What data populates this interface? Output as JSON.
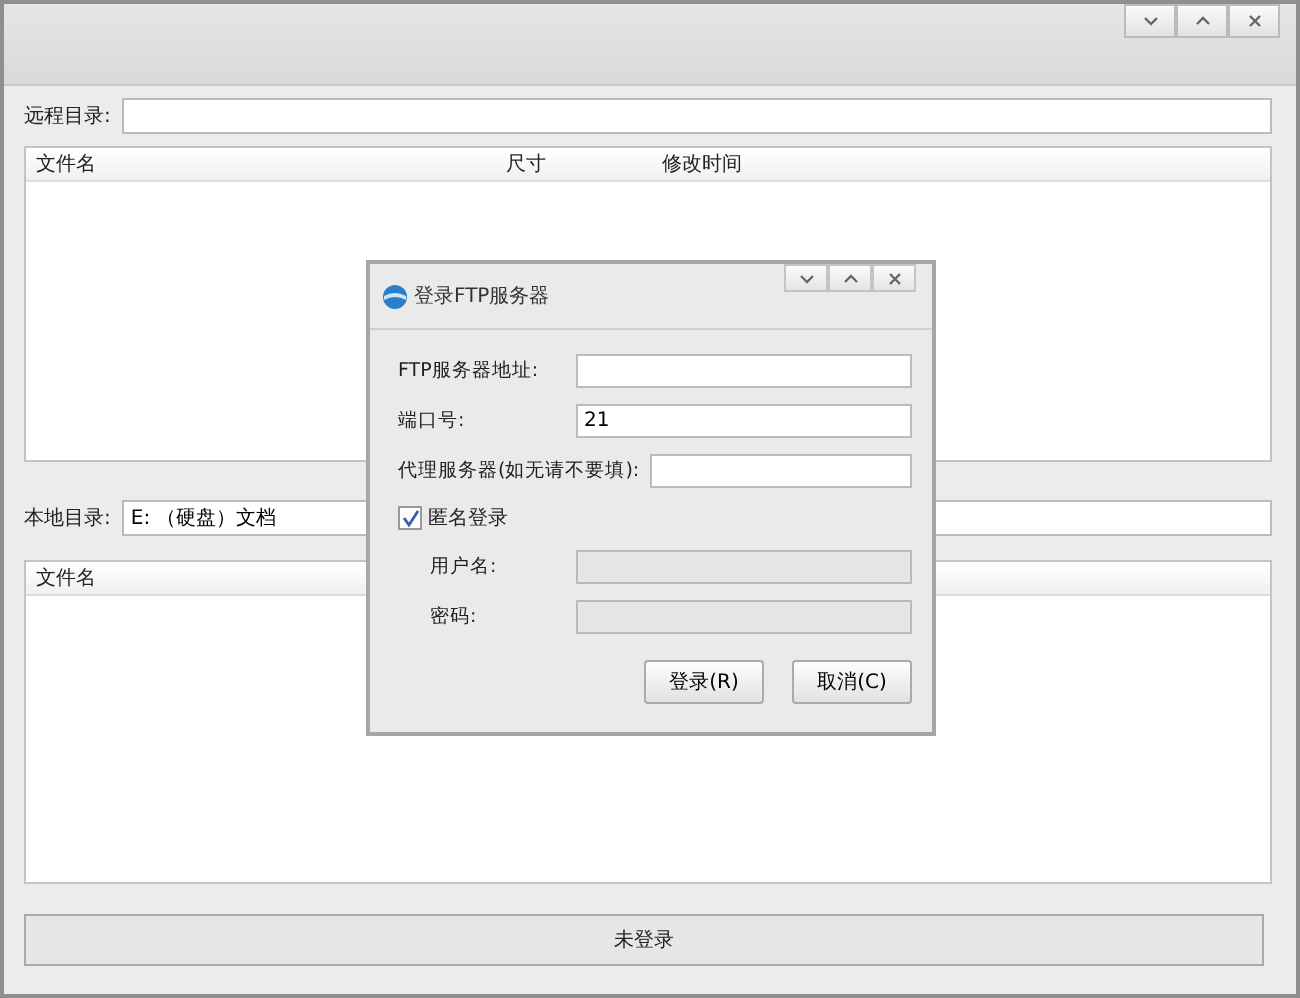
{
  "remote": {
    "label": "远程目录:",
    "columns": [
      "文件名",
      "尺寸",
      "修改时间"
    ]
  },
  "local": {
    "label": "本地目录:",
    "value": "E: （硬盘）文档",
    "columns": [
      "文件名"
    ]
  },
  "status": "未登录",
  "dialog": {
    "title": "登录FTP服务器",
    "fields": [
      {
        "label": "FTP服务器地址:"
      },
      {
        "label": "端口号:",
        "value": "21"
      },
      {
        "label": "代理服务器(如无请不要填):"
      }
    ],
    "anonymous": {
      "label": "匿名登录",
      "checked": true
    },
    "auth_fields": [
      {
        "label": "用户名:"
      },
      {
        "label": "密码:"
      }
    ],
    "buttons": [
      "登录(R)",
      "取消(C)"
    ]
  }
}
